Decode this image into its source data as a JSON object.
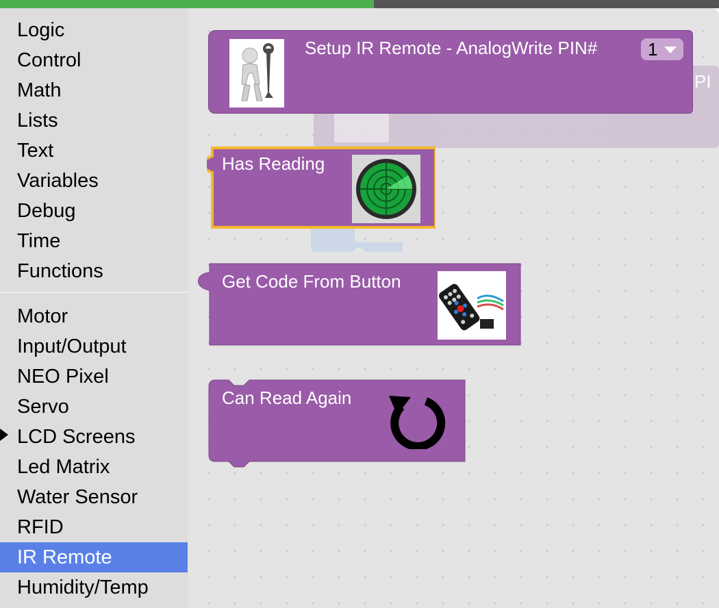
{
  "progress_fraction": 0.52,
  "toolbox": {
    "categories": [
      "Logic",
      "Control",
      "Math",
      "Lists",
      "Text",
      "Variables",
      "Debug",
      "Time",
      "Functions"
    ],
    "categories_2": [
      "Motor",
      "Input/Output",
      "NEO Pixel",
      "Servo",
      "LCD Screens",
      "Led Matrix",
      "Water Sensor",
      "RFID",
      "IR Remote",
      "Humidity/Temp"
    ],
    "selected": "IR Remote",
    "expandable_marker_on": "LCD Screens"
  },
  "blocks": {
    "setup": {
      "label": "Setup IR Remote - AnalogWrite PIN#",
      "pin_value": "1",
      "image_icon": "mechanic-with-wrench-image"
    },
    "ghost_setup": {
      "label_fragment": "PI"
    },
    "has_reading": {
      "label": "Has Reading",
      "image_icon": "radar-image"
    },
    "get_code": {
      "label": "Get Code From Button",
      "image_icon": "ir-remote-kit-image"
    },
    "read_again": {
      "label": "Can Read Again",
      "image_icon": "reset-arrow-icon"
    }
  },
  "colors": {
    "block_purple": "#9a5ba8",
    "selected_block_outline": "#f3b82b",
    "toolbox_selected": "#5a80e8",
    "progress_green": "#4caf50"
  }
}
